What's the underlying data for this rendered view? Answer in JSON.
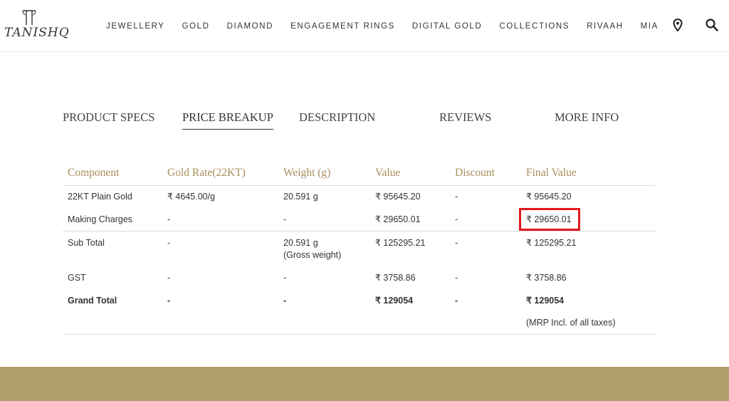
{
  "brand": {
    "logo_text": "TANISHQ"
  },
  "nav": {
    "items": [
      "JEWELLERY",
      "GOLD",
      "DIAMOND",
      "ENGAGEMENT RINGS",
      "DIGITAL GOLD",
      "COLLECTIONS",
      "RIVAAH",
      "MIA"
    ]
  },
  "header_icons": {
    "location": "map-pin-icon",
    "search": "search-icon"
  },
  "tabs": [
    {
      "label": "PRODUCT SPECS",
      "active": false
    },
    {
      "label": "PRICE BREAKUP",
      "active": true
    },
    {
      "label": "DESCRIPTION",
      "active": false
    },
    {
      "label": "REVIEWS",
      "active": false
    },
    {
      "label": "MORE INFO",
      "active": false
    }
  ],
  "table": {
    "headers": [
      "Component",
      "Gold Rate(22KT)",
      "Weight (g)",
      "Value",
      "Discount",
      "Final Value"
    ],
    "rows": [
      {
        "component": "22KT Plain Gold",
        "gold_rate": "₹ 4645.00/g",
        "weight": "20.591 g",
        "weight_note": "",
        "value": "₹ 95645.20",
        "discount": "-",
        "final_value": "₹ 95645.20"
      },
      {
        "component": "Making Charges",
        "gold_rate": "-",
        "weight": "-",
        "weight_note": "",
        "value": "₹ 29650.01",
        "discount": "-",
        "final_value": "₹ 29650.01"
      },
      {
        "component": "Sub Total",
        "gold_rate": "-",
        "weight": "20.591 g",
        "weight_note": "(Gross weight)",
        "value": "₹ 125295.21",
        "discount": "-",
        "final_value": "₹ 125295.21"
      },
      {
        "component": "GST",
        "gold_rate": "-",
        "weight": "-",
        "weight_note": "",
        "value": "₹ 3758.86",
        "discount": "-",
        "final_value": "₹ 3758.86"
      },
      {
        "component": "Grand Total",
        "gold_rate": "-",
        "weight": "-",
        "weight_note": "",
        "value": "₹ 129054",
        "discount": "-",
        "final_value": "₹ 129054"
      }
    ],
    "mrp_note": "(MRP Incl. of all taxes)"
  },
  "colors": {
    "accent_gold": "#a88f5b",
    "footer_band": "#b09e6c",
    "highlight_red": "#e1181d"
  }
}
